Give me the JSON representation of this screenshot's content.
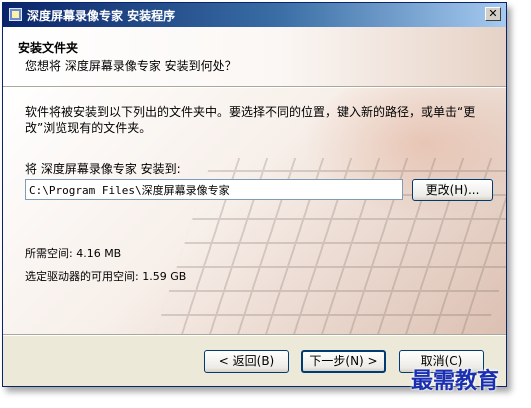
{
  "window": {
    "title": "深度屏幕录像专家 安装程序",
    "close_glyph": "✕"
  },
  "header": {
    "title": "安装文件夹",
    "subtitle": "您想将 深度屏幕录像专家 安装到何处？"
  },
  "body": {
    "description": "软件将被安装到以下列出的文件夹中。要选择不同的位置，键入新的路径，或单击“更改”浏览现有的文件夹。",
    "install_label": "将 深度屏幕录像专家 安装到:",
    "install_path": "C:\\Program Files\\深度屏幕录像专家",
    "browse_label": "更改(H)...",
    "space_required": "所需空间: 4.16 MB",
    "space_available": "选定驱动器的可用空间: 1.59 GB"
  },
  "footer": {
    "back_label": "< 返回(B)",
    "next_label": "下一步(N) >",
    "cancel_label": "取消(C)"
  },
  "watermark": "最需教育"
}
